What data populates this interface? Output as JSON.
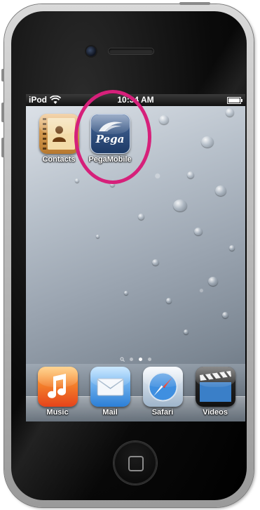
{
  "status_bar": {
    "carrier": "iPod",
    "time": "10:34 AM"
  },
  "home_screen": {
    "apps": [
      {
        "label": "Contacts",
        "icon": "contacts-icon"
      },
      {
        "label": "PegaMobile",
        "icon": "pega-icon",
        "icon_text": "Pega"
      }
    ]
  },
  "page_indicator": {
    "pages": 3,
    "current": 2
  },
  "dock": {
    "apps": [
      {
        "label": "Music",
        "icon": "music-icon"
      },
      {
        "label": "Mail",
        "icon": "mail-icon"
      },
      {
        "label": "Safari",
        "icon": "safari-icon"
      },
      {
        "label": "Videos",
        "icon": "videos-icon"
      }
    ]
  },
  "colors": {
    "highlight_ring": "#d6207a"
  }
}
